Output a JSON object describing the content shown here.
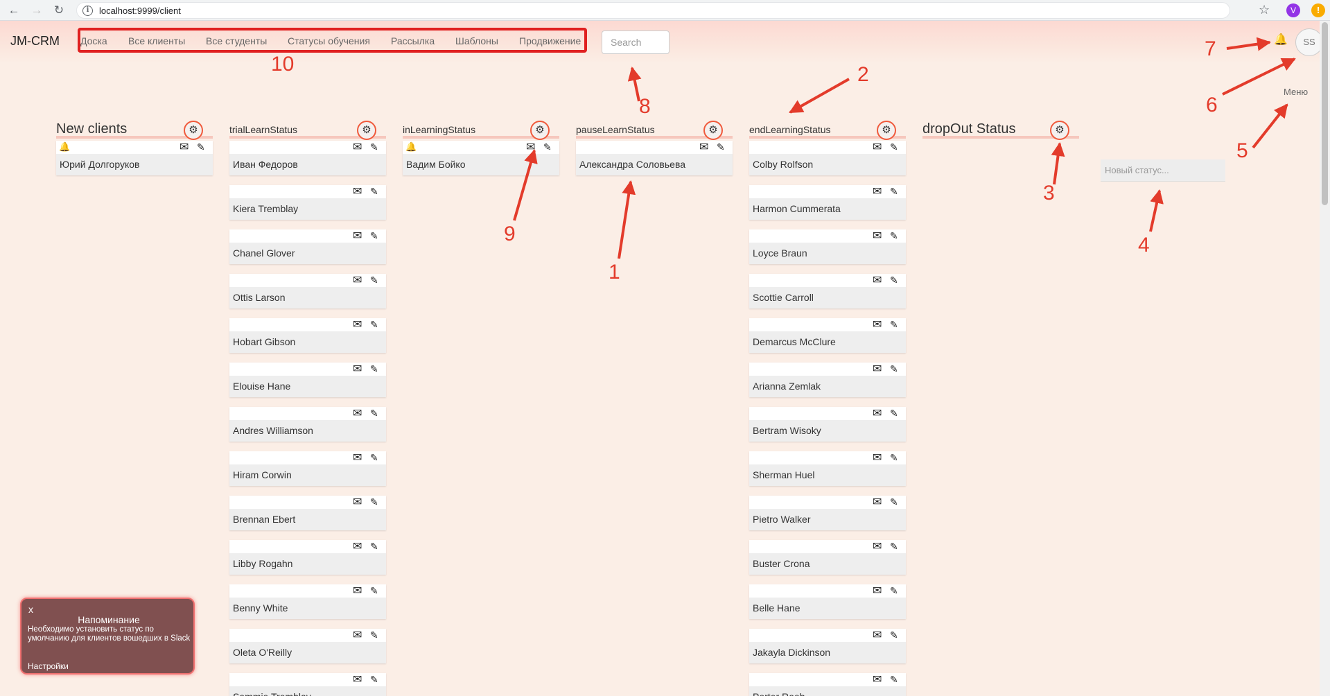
{
  "browser": {
    "url": "localhost:9999/client",
    "back_icon": "←",
    "forward_icon": "→",
    "reload_icon": "↻",
    "star_icon": "☆",
    "profile_initial": "V",
    "update_icon": "!"
  },
  "header": {
    "brand": "JM-CRM",
    "nav": [
      "Доска",
      "Все клиенты",
      "Все студенты",
      "Статусы обучения",
      "Рассылка",
      "Шаблоны",
      "Продвижение"
    ],
    "search_placeholder": "Search",
    "bell_icon": "🔔",
    "avatar": "SS",
    "menu_label": "Меню"
  },
  "board": {
    "new_status_placeholder": "Новый статус...",
    "columns": [
      {
        "title": "New clients",
        "big": true,
        "cards": [
          {
            "name": "Юрий Долгоруков",
            "bell": true
          }
        ]
      },
      {
        "title": "trialLearnStatus",
        "big": false,
        "cards": [
          {
            "name": "Иван Федоров"
          },
          {
            "name": "Kiera Tremblay"
          },
          {
            "name": "Chanel Glover"
          },
          {
            "name": "Ottis Larson"
          },
          {
            "name": "Hobart Gibson"
          },
          {
            "name": "Elouise Hane"
          },
          {
            "name": "Andres Williamson"
          },
          {
            "name": "Hiram Corwin"
          },
          {
            "name": "Brennan Ebert"
          },
          {
            "name": "Libby Rogahn"
          },
          {
            "name": "Benny White"
          },
          {
            "name": "Oleta O'Reilly"
          },
          {
            "name": "Sammie Tremblay"
          }
        ]
      },
      {
        "title": "inLearningStatus",
        "big": false,
        "cards": [
          {
            "name": "Вадим Бойко",
            "bell": true
          }
        ]
      },
      {
        "title": "pauseLearnStatus",
        "big": false,
        "cards": [
          {
            "name": "Александра Соловьева"
          }
        ]
      },
      {
        "title": "endLearningStatus",
        "big": false,
        "cards": [
          {
            "name": "Colby Rolfson"
          },
          {
            "name": "Harmon Cummerata"
          },
          {
            "name": "Loyce Braun"
          },
          {
            "name": "Scottie Carroll"
          },
          {
            "name": "Demarcus McClure"
          },
          {
            "name": "Arianna Zemlak"
          },
          {
            "name": "Bertram Wisoky"
          },
          {
            "name": "Sherman Huel"
          },
          {
            "name": "Pietro Walker"
          },
          {
            "name": "Buster Crona"
          },
          {
            "name": "Belle Hane"
          },
          {
            "name": "Jakayla Dickinson"
          },
          {
            "name": "Porter Roob"
          }
        ]
      },
      {
        "title": "dropOut Status",
        "big": true,
        "cards": []
      }
    ]
  },
  "icons": {
    "gear": "⚙",
    "mail": "✉",
    "edit": "✎",
    "bell": "🔔"
  },
  "reminder": {
    "close": "x",
    "title": "Напоминание",
    "text": "Необходимо установить статус по умолчанию для клиентов вошедших в Slack",
    "settings": "Настройки"
  },
  "annotations": {
    "color": "#e33b2b",
    "labels": [
      "1",
      "2",
      "3",
      "4",
      "5",
      "6",
      "7",
      "8",
      "9",
      "10"
    ]
  }
}
